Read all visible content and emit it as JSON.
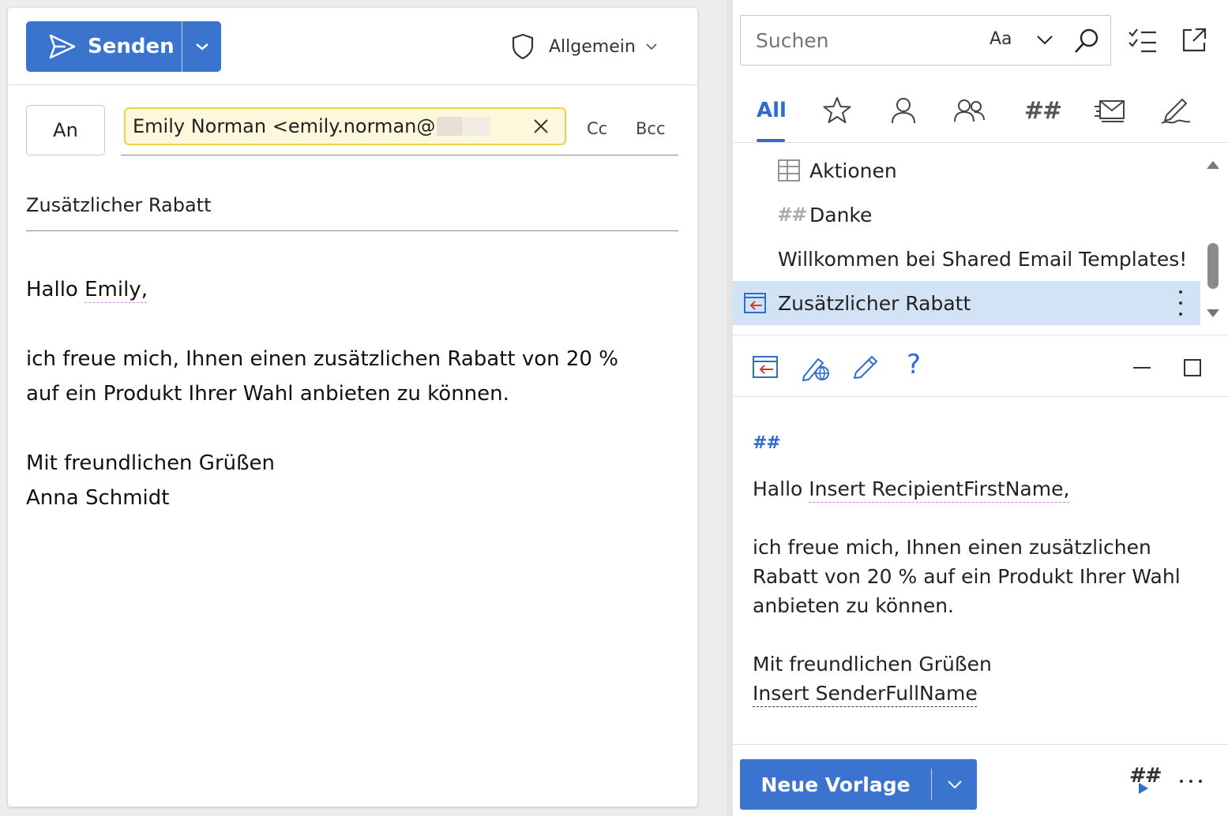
{
  "compose": {
    "send_label": "Senden",
    "sensitivity_label": "Allgemein",
    "to_label": "An",
    "recipient_chip": "Emily Norman <emily.norman@",
    "cc_label": "Cc",
    "bcc_label": "Bcc",
    "subject": "Zusätzlicher Rabatt",
    "body": {
      "greeting_prefix": "Hallo ",
      "greeting_name": "Emily,",
      "line1": "ich freue mich, Ihnen einen zusätzlichen Rabatt von 20 %",
      "line2": "auf ein Produkt Ihrer Wahl anbieten zu können.",
      "closing": "Mit freundlichen Grüßen",
      "signature": "Anna Schmidt"
    }
  },
  "addin": {
    "search": {
      "placeholder": "Suchen",
      "match_case_label": "Aa"
    },
    "categories": {
      "all_label": "All",
      "hashtag_label": "##"
    },
    "templates": [
      {
        "label": "Aktionen",
        "icon": "table-icon"
      },
      {
        "label": "Danke",
        "prefix": "##"
      },
      {
        "label": "Willkommen bei Shared Email Templates!"
      },
      {
        "label": "Zusätzlicher Rabatt",
        "icon": "insert-template-icon",
        "selected": true
      }
    ],
    "preview": {
      "hashtag": "##",
      "greeting_prefix": "Hallo ",
      "greeting_macro": "Insert RecipientFirstName,",
      "line1": "ich freue mich, Ihnen einen zusätzlichen",
      "line2": "Rabatt von 20 % auf ein Produkt Ihrer Wahl",
      "line3": "anbieten zu können.",
      "closing": "Mit freundlichen Grüßen",
      "signature_macro": "Insert SenderFullName"
    },
    "help_label": "?",
    "new_template_label": "Neue Vorlage",
    "footer_hash": "##"
  },
  "colors": {
    "accent": "#3b74cf",
    "selected_row": "#d2e3f6",
    "chip_bg": "#fdf8dc",
    "chip_border": "#f2cf4e"
  }
}
